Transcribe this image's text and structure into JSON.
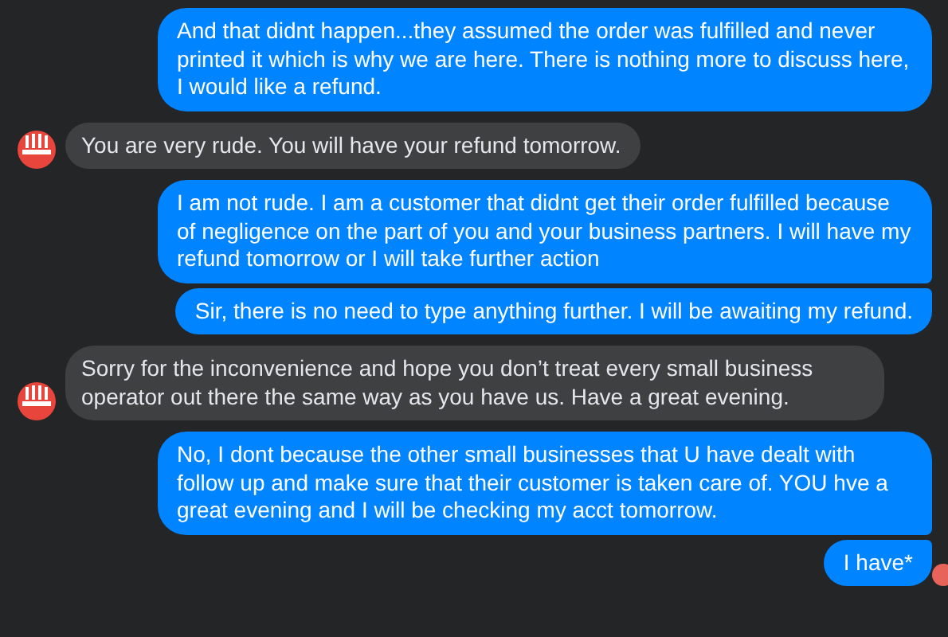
{
  "messages": [
    {
      "kind": "outgoing",
      "text": "And that didnt happen...they assumed the order was fulfilled and never printed it which is why we are here. There is nothing more to discuss here, I would like a refund.",
      "seen": false
    },
    {
      "kind": "incoming",
      "text": "You are very rude.  You will have your refund tomorrow.",
      "seen": false
    },
    {
      "kind": "outgoing",
      "text": "I am not rude. I am a customer that didnt get their order fulfilled because of negligence on the part of you and your business partners. I will have my refund tomorrow or I will take further action",
      "seen": false
    },
    {
      "kind": "outgoing",
      "text": "Sir, there is no need to type anything further. I will be awaiting my refund.",
      "seen": false
    },
    {
      "kind": "incoming",
      "text": "Sorry for the inconvenience and hope you don’t treat every small business operator out there the same way as you have us.  Have a great evening.",
      "seen": false
    },
    {
      "kind": "outgoing",
      "text": "No, I dont because the other small businesses that U have dealt with follow up and make sure that their customer is taken care of. YOU hve a great evening and I will be checking my acct tomorrow.",
      "seen": false
    },
    {
      "kind": "outgoing",
      "text": "I have*",
      "seen": true
    }
  ]
}
